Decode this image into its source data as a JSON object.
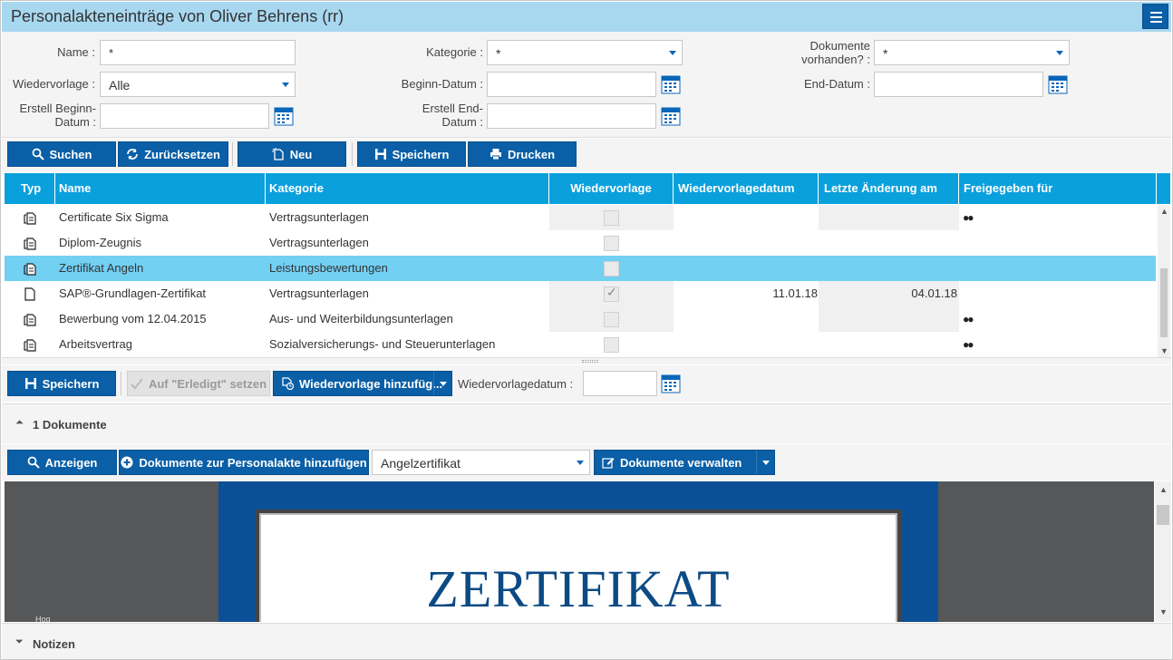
{
  "window": {
    "title": "Personalakteneinträge von Oliver Behrens (rr)"
  },
  "filters": {
    "name_label": "Name :",
    "name_value": "*",
    "kategorie_label": "Kategorie :",
    "kategorie_value": "*",
    "dokumente_label_1": "Dokumente",
    "dokumente_label_2": "vorhanden? :",
    "dokumente_value": "*",
    "wiedervorlage_label": "Wiedervorlage :",
    "wiedervorlage_value": "Alle",
    "beginn_label": "Beginn-Datum :",
    "beginn_value": "",
    "end_label": "End-Datum :",
    "end_value": "",
    "erstell_beginn_label_1": "Erstell Beginn-",
    "erstell_beginn_label_2": "Datum :",
    "erstell_beginn_value": "",
    "erstell_end_label_1": "Erstell End-",
    "erstell_end_label_2": "Datum :",
    "erstell_end_value": ""
  },
  "toolbar": {
    "suchen": "Suchen",
    "zuruecksetzen": "Zurücksetzen",
    "neu": "Neu",
    "speichern": "Speichern",
    "drucken": "Drucken"
  },
  "grid": {
    "columns": [
      "Typ",
      "Name",
      "Kategorie",
      "Wiedervorlage",
      "Wiedervorlagedatum",
      "Letzte Änderung am",
      "Freigegeben für"
    ],
    "rows": [
      {
        "name": "Certificate Six Sigma",
        "kategorie": "Vertragsunterlagen",
        "wiedervorlage": false,
        "wv_datum": "",
        "letzte": "",
        "freigegeben": "people-icon",
        "icon": "document-stack-icon"
      },
      {
        "name": "Diplom-Zeugnis",
        "kategorie": "Vertragsunterlagen",
        "wiedervorlage": false,
        "wv_datum": "",
        "letzte": "",
        "freigegeben": "",
        "icon": "document-stack-icon"
      },
      {
        "name": "Zertifikat Angeln",
        "kategorie": "Leistungsbewertungen",
        "wiedervorlage": false,
        "wv_datum": "",
        "letzte": "",
        "freigegeben": "",
        "icon": "document-stack-icon",
        "selected": true
      },
      {
        "name": "SAP®-Grundlagen-Zertifikat",
        "kategorie": "Vertragsunterlagen",
        "wiedervorlage": true,
        "wv_datum": "11.01.18",
        "letzte": "04.01.18",
        "freigegeben": "",
        "icon": "document-icon"
      },
      {
        "name": "Bewerbung vom 12.04.2015",
        "kategorie": "Aus- und Weiterbildungsunterlagen",
        "wiedervorlage": false,
        "wv_datum": "",
        "letzte": "",
        "freigegeben": "people-icon",
        "icon": "document-stack-icon"
      },
      {
        "name": "Arbeitsvertrag",
        "kategorie": "Sozialversicherungs- und Steuerunterlagen",
        "wiedervorlage": false,
        "wv_datum": "",
        "letzte": "",
        "freigegeben": "people-icon",
        "icon": "document-stack-icon"
      }
    ]
  },
  "toolbar2": {
    "speichern": "Speichern",
    "erledigt": "Auf \"Erledigt\" setzen",
    "wiedervorlage_add": "Wiedervorlage hinzufüg...",
    "wv_datum_label": "Wiedervorlagedatum :",
    "wv_datum_value": ""
  },
  "documents": {
    "section_label": "1 Dokumente",
    "anzeigen": "Anzeigen",
    "hinzufuegen": "Dokumente zur Personalakte hinzufügen",
    "selected_doc": "Angelzertifikat",
    "verwalten": "Dokumente verwalten",
    "preview_title": "ZERTIFIKAT",
    "preview_small": "Hog"
  },
  "notes": {
    "label": "Notizen"
  },
  "colors": {
    "primary": "#0a5fa6",
    "header": "#0aa0dc",
    "selected_row": "#72d0f3",
    "titlebar": "#a8d7f0",
    "cert_blue": "#0b4f96"
  }
}
